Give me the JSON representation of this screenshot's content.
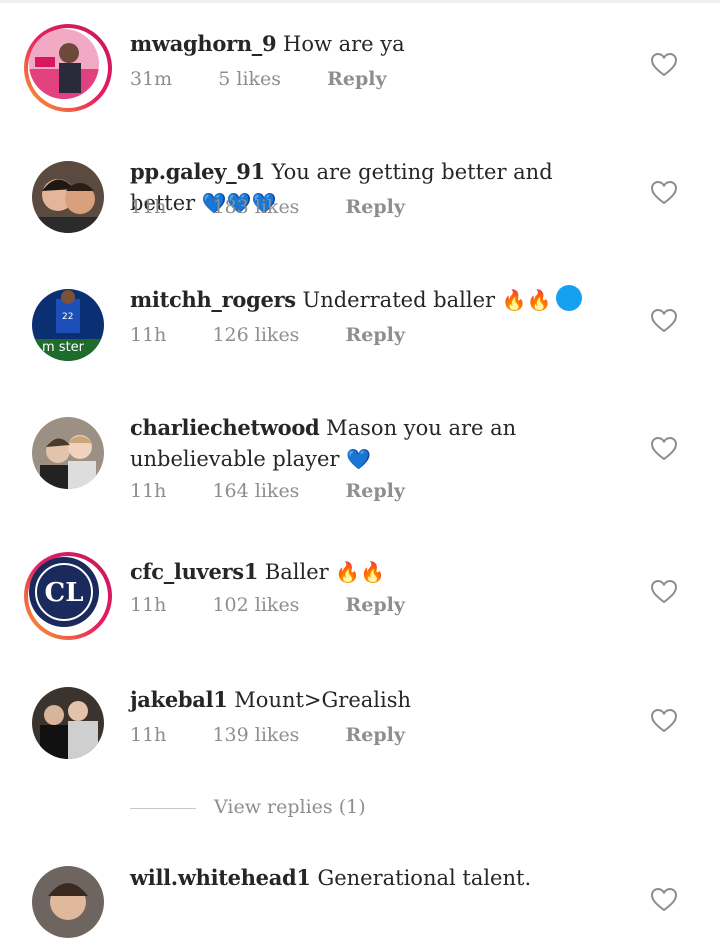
{
  "comments": [
    {
      "username": "mwaghorn_9",
      "text": "How are ya",
      "emoji": "",
      "time": "31m",
      "likes": "5 likes",
      "reply": "Reply"
    },
    {
      "username": "pp.galey_91",
      "text": "You are getting better and better",
      "emoji": "💙💙💙",
      "time": "11h",
      "likes": "183 likes",
      "reply": "Reply"
    },
    {
      "username": "mitchh_rogers",
      "text": "Underrated baller",
      "emoji": "🔥🔥",
      "time": "11h",
      "likes": "126 likes",
      "reply": "Reply"
    },
    {
      "username": "charliechetwood",
      "text": "Mason you are an unbelievable player",
      "emoji": "💙",
      "time": "11h",
      "likes": "164 likes",
      "reply": "Reply"
    },
    {
      "username": "cfc_luvers1",
      "text": "Baller",
      "emoji": "🔥🔥",
      "time": "11h",
      "likes": "102 likes",
      "reply": "Reply"
    },
    {
      "username": "jakebal1",
      "text": "Mount>Grealish",
      "emoji": "",
      "time": "11h",
      "likes": "139 likes",
      "reply": "Reply"
    },
    {
      "username": "will.whitehead1",
      "text": "Generational talent.",
      "emoji": ""
    }
  ],
  "view_replies": "View replies (1)",
  "avatar_4_logo": "CL",
  "colors": {
    "meta": "#8e8e8e",
    "heart_emoji": "#3fb7e8",
    "blue_circle": "#16a0f0"
  }
}
